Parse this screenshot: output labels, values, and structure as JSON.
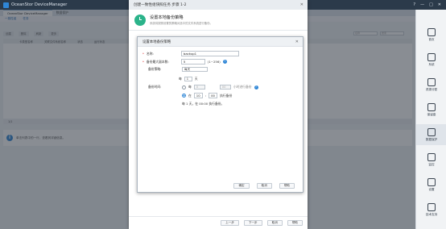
{
  "app": {
    "title": "OceanStor DeviceManager",
    "controls": [
      "?",
      "—",
      "□",
      "✕"
    ]
  },
  "tabs": [
    {
      "label": "OceanStor DeviceManager",
      "active": true
    },
    {
      "label": "数据保护",
      "active": false
    }
  ],
  "subbar": {
    "items": [
      "一致性组",
      "任务"
    ]
  },
  "toolbar": {
    "buttons": [
      "创建",
      "删除",
      "刷新",
      "更多"
    ]
  },
  "filter": {
    "placeholders": [
      "名称",
      "搜索"
    ]
  },
  "table": {
    "columns": [
      "卡类型名称",
      "关联文件系统名称",
      "状态",
      "运行状态"
    ]
  },
  "pager": {
    "text": "1/1"
  },
  "detail": {
    "text": "单击列表中的一行，查看其详细信息。"
  },
  "sidebar": {
    "items": [
      {
        "label": "首页",
        "icon": "home-icon"
      },
      {
        "label": "系统",
        "icon": "system-icon"
      },
      {
        "label": "资源分配",
        "icon": "allocation-icon"
      },
      {
        "label": "保留盘",
        "icon": "disk-icon"
      },
      {
        "label": "数据保护",
        "icon": "shield-icon",
        "active": true
      },
      {
        "label": "监控",
        "icon": "monitor-icon"
      },
      {
        "label": "设置",
        "icon": "settings-icon"
      },
      {
        "label": "技术支持",
        "icon": "support-icon"
      }
    ]
  },
  "wizard": {
    "title": "创建一致性组快照任务 步骤 1-2",
    "heading": "设置本地备份策略",
    "subheading": "系统将按照设置的策略对选中的文件系统进行备份。",
    "buttons": {
      "prev": "上一步",
      "next": "下一步",
      "cancel": "取消",
      "help": "帮助"
    }
  },
  "dialog": {
    "title": "设置本地备份策略",
    "name_label": "名称:",
    "name_value": "backup1",
    "max_label": "备份最大副本数:",
    "max_value": "5",
    "max_range": "(1~256)",
    "policy_label": "备份策略:",
    "policy_value": "每天",
    "time_label": "备份时间:",
    "every_label": "每",
    "every_value": "1",
    "day_unit": "天",
    "every_time": "0",
    "every_time2": "00",
    "every_suffix": "小时进行备份",
    "at_label": "在",
    "at_hour": "10",
    "at_min": "00",
    "at_suffix": "执行备份",
    "summary": "每 1 天，在 00:00 执行备份。",
    "buttons": {
      "ok": "确定",
      "cancel": "取消",
      "help": "帮助"
    }
  },
  "colors": {
    "accent": "#2f86d6",
    "brand_green": "#2bb38a",
    "titlebar": "#2b3a4a"
  }
}
